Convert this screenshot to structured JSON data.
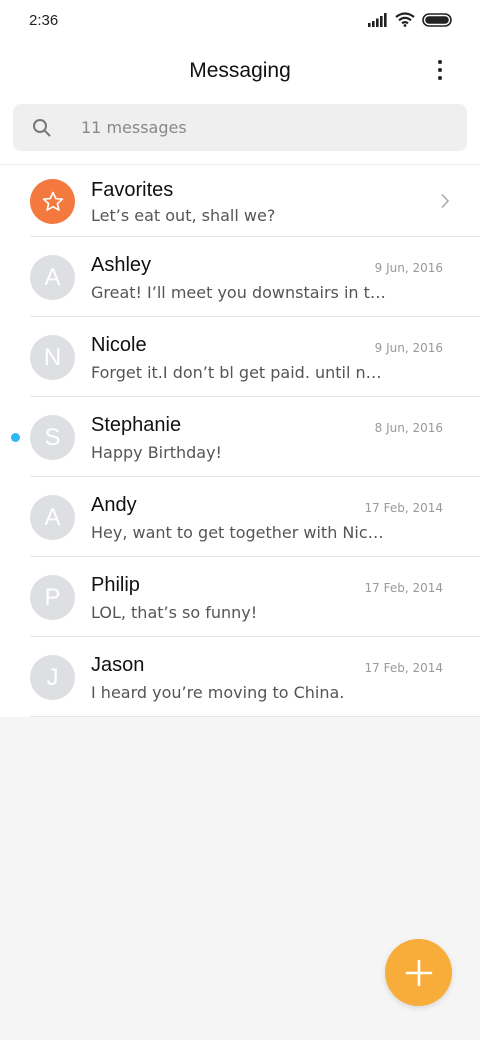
{
  "status_bar": {
    "time": "2:36"
  },
  "header": {
    "title": "Messaging"
  },
  "search": {
    "placeholder": "11 messages"
  },
  "conversations": [
    {
      "name": "Favorites",
      "preview": "Let’s eat out, shall we?",
      "date": "",
      "initial": "",
      "unread": false
    },
    {
      "name": "Ashley",
      "preview": "Great! I’ll meet you downstairs in te...",
      "date": "9 Jun, 2016",
      "initial": "A",
      "unread": false
    },
    {
      "name": "Nicole",
      "preview": "Forget it.I don’t bl get paid. until nex...",
      "date": "9 Jun, 2016",
      "initial": "N",
      "unread": false
    },
    {
      "name": "Stephanie",
      "preview": "Happy Birthday!",
      "date": "8 Jun, 2016",
      "initial": "S",
      "unread": true
    },
    {
      "name": "Andy",
      "preview": "Hey, want to get together with Nicol...",
      "date": "17 Feb, 2014",
      "initial": "A",
      "unread": false
    },
    {
      "name": "Philip",
      "preview": "LOL, that’s so funny!",
      "date": "17 Feb, 2014",
      "initial": "P",
      "unread": false
    },
    {
      "name": "Jason",
      "preview": "I heard you’re moving to China.",
      "date": "17 Feb, 2014",
      "initial": "J",
      "unread": false
    }
  ],
  "colors": {
    "favorites_accent": "#f4793f",
    "fab": "#f8ad3a",
    "unread_dot": "#2fb6f5",
    "avatar_bg": "#dddfe2"
  },
  "icons": {
    "favorites": "star-icon",
    "fab": "plus-icon",
    "search": "search-icon",
    "more": "more-vertical-icon"
  }
}
